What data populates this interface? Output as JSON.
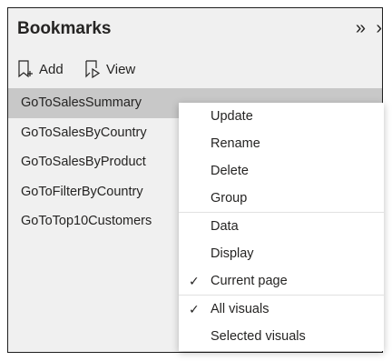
{
  "pane": {
    "title": "Bookmarks",
    "collapse_glyph": "»",
    "next_glyph": "›",
    "toolbar": {
      "add_label": "Add",
      "view_label": "View",
      "add_icon": "add-bookmark-icon",
      "view_icon": "view-slideshow-icon"
    },
    "bookmarks": [
      "GoToSalesSummary",
      "GoToSalesByCountry",
      "GoToSalesByProduct",
      "GoToFilterByCountry",
      "GoToTop10Customers"
    ],
    "more_glyph": "···"
  },
  "context_menu": {
    "group1": [
      "Update",
      "Rename",
      "Delete",
      "Group"
    ],
    "group2": [
      "Data",
      "Display",
      "Current page"
    ],
    "group3": [
      "All visuals",
      "Selected visuals"
    ],
    "checked_glyph": "✓",
    "checked_items": [
      "Current page",
      "All visuals"
    ]
  },
  "colors": {
    "pane_bg": "#f0f0f0",
    "selected_bg": "#c8c8c8",
    "menu_bg": "#ffffff",
    "text": "#252423"
  }
}
